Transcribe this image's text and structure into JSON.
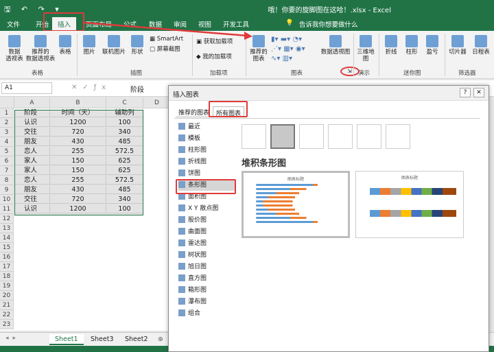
{
  "window": {
    "title": "哦！你要的旋脚图在这哈！.xlsx  -  Excel"
  },
  "ribbon_tabs": [
    "文件",
    "开始",
    "插入",
    "页面布局",
    "公式",
    "数据",
    "审阅",
    "视图",
    "开发工具"
  ],
  "tellme": "告诉我你想要做什么",
  "ribbon": {
    "tables": [
      "数据\n透视表",
      "推荐的\n数据透视表",
      "表格"
    ],
    "illustrations": [
      "图片",
      "联机图片",
      "形状"
    ],
    "smartart": "SmartArt",
    "screenshot": "屏幕截图",
    "addins": [
      "获取加载项",
      "我的加载项"
    ],
    "charts": [
      "推荐的\n图表",
      "数据透视图"
    ],
    "map": "三维地\n图",
    "sparklines": [
      "折线",
      "柱形",
      "盈亏"
    ],
    "filters": [
      "切片器",
      "日程表"
    ],
    "groups": {
      "tables": "表格",
      "illustrations": "插图",
      "addins": "加载项",
      "charts": "图表",
      "tours": "演示",
      "sparklines": "迷你图",
      "filters": "筛选器"
    }
  },
  "formula_bar": {
    "name_box": "A1",
    "value": "阶段"
  },
  "columns": [
    "A",
    "B",
    "C",
    "D"
  ],
  "table_rows": [
    [
      "阶段",
      "时间（天）",
      "辅助列"
    ],
    [
      "认识",
      "1200",
      "100"
    ],
    [
      "交往",
      "720",
      "340"
    ],
    [
      "朋友",
      "430",
      "485"
    ],
    [
      "恋人",
      "255",
      "572.5"
    ],
    [
      "家人",
      "150",
      "625"
    ],
    [
      "家人",
      "150",
      "625"
    ],
    [
      "恋人",
      "255",
      "572.5"
    ],
    [
      "朋友",
      "430",
      "485"
    ],
    [
      "交往",
      "720",
      "340"
    ],
    [
      "认识",
      "1200",
      "100"
    ]
  ],
  "row_numbers": [
    "1",
    "2",
    "3",
    "4",
    "5",
    "6",
    "7",
    "8",
    "9",
    "10",
    "11",
    "12",
    "13",
    "14",
    "15",
    "16",
    "17",
    "18",
    "19",
    "20",
    "21",
    "22",
    "23"
  ],
  "sheets": [
    "Sheet1",
    "Sheet3",
    "Sheet2"
  ],
  "dialog": {
    "title": "插入图表",
    "tabs": [
      "推荐的图表",
      "所有图表"
    ],
    "chart_types": [
      "最近",
      "模板",
      "柱形图",
      "折线图",
      "饼图",
      "条形图",
      "面积图",
      "X Y 散点图",
      "股价图",
      "曲面图",
      "雷达图",
      "树状图",
      "旭日图",
      "直方图",
      "箱形图",
      "瀑布图",
      "组合"
    ],
    "selected_type": "条形图",
    "subtype_title": "堆积条形图",
    "preview_title": "图表标题",
    "preview_title_2": "图表标题",
    "help": "?",
    "close": "✕"
  },
  "colors": {
    "excel_green": "#217346",
    "highlight": "#e03a3a",
    "bar_blue": "#5b9bd5",
    "bar_orange": "#ed7d31"
  }
}
